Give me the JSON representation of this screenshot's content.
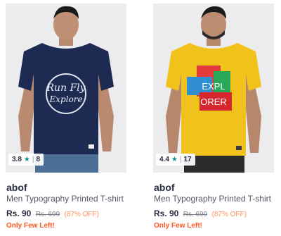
{
  "products": [
    {
      "brand": "abof",
      "title": "Men Typography Printed T-shirt",
      "price": "Rs. 90",
      "mrp": "Rs. 699",
      "discount": "(87% OFF)",
      "stock_note": "Only Few Left!",
      "rating": "3.8",
      "rating_count": "8",
      "tshirt_color": "#1d2a52",
      "print_text": "Run Fly Explore"
    },
    {
      "brand": "abof",
      "title": "Men Typography Printed T-shirt",
      "price": "Rs. 90",
      "mrp": "Rs. 699",
      "discount": "(87% OFF)",
      "stock_note": "Only Few Left!",
      "rating": "4.4",
      "rating_count": "17",
      "tshirt_color": "#f1c21b",
      "print_text_line1": "EXPL",
      "print_text_line2": "ORER"
    }
  ],
  "icons": {
    "rating_star": "star-icon"
  }
}
